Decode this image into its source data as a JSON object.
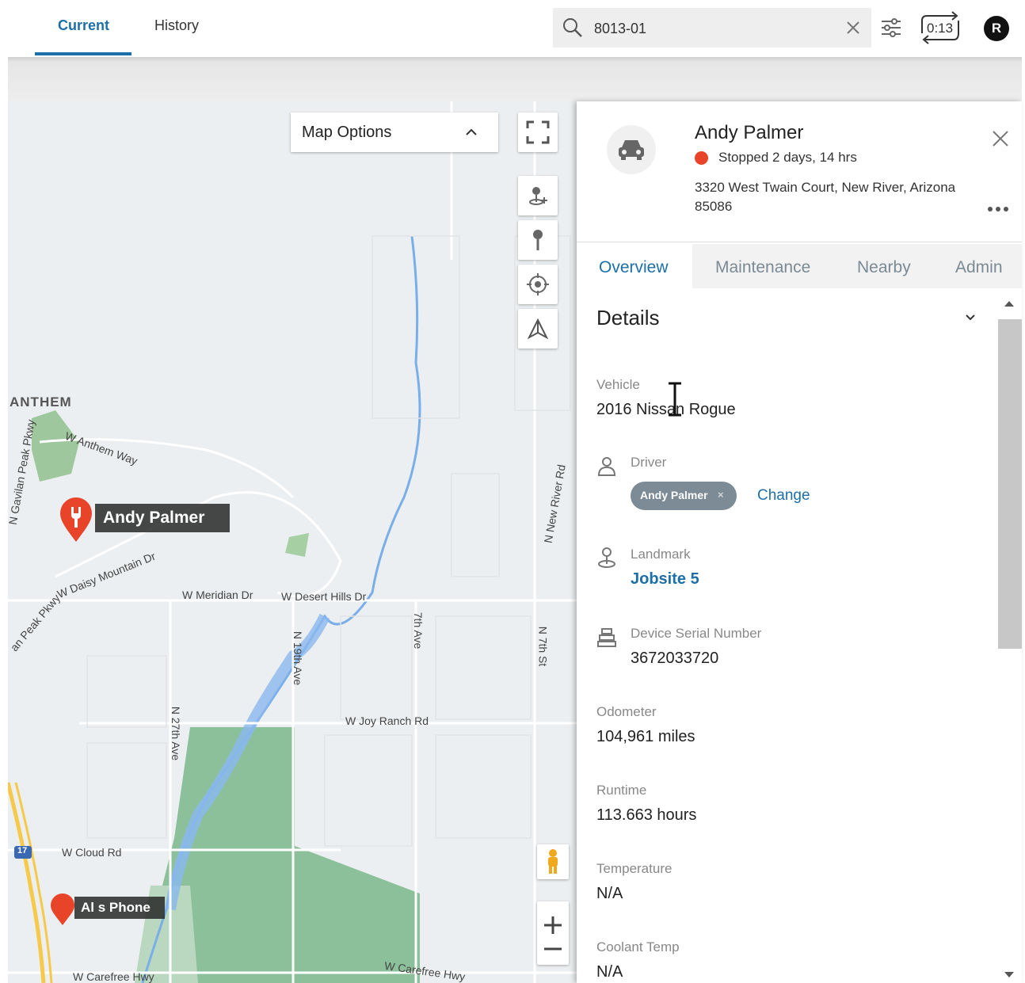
{
  "topbar": {
    "tabs": [
      {
        "label": "Current"
      },
      {
        "label": "History"
      }
    ],
    "search": {
      "value": "8013-01"
    },
    "timer": "0:13",
    "user_initial": "R"
  },
  "map": {
    "options_label": "Map Options",
    "markers": [
      {
        "label": "Andy Palmer"
      },
      {
        "label": "Al s Phone"
      }
    ],
    "places": {
      "anthem": "ANTHEM",
      "w_anthem_way": "W Anthem Way",
      "w_daisy": "W Daisy Mountain Dr",
      "w_meridian": "W Meridian Dr",
      "w_desert_hills": "W Desert Hills Dr",
      "n19th": "N 19th Ave",
      "ave7": "7th Ave",
      "n7th": "N 7th St",
      "w_joy": "W Joy Ranch Rd",
      "n27th": "N 27th Ave",
      "w_cloud": "W Cloud Rd",
      "w_carefree1": "W Carefree Hwy",
      "w_carefree2": "W Carefree Hwy",
      "n_new_river": "N New River Rd",
      "gavilan": "N Gavilan Peak Pkwy",
      "peak_pkwy": "an Peak Pkwy",
      "hwy17": "17"
    }
  },
  "panel": {
    "name": "Andy Palmer",
    "status": "Stopped 2 days, 14 hrs",
    "status_color": "#e8442a",
    "address": "3320 West Twain Court, New River, Arizona 85086",
    "tabs": [
      {
        "label": "Overview"
      },
      {
        "label": "Maintenance"
      },
      {
        "label": "Nearby"
      },
      {
        "label": "Admin"
      }
    ],
    "section_title": "Details",
    "vehicle": {
      "label": "Vehicle",
      "value": "2016 Nissan Rogue"
    },
    "driver": {
      "label": "Driver",
      "chip": "Andy Palmer",
      "change": "Change"
    },
    "landmark": {
      "label": "Landmark",
      "value": "Jobsite 5"
    },
    "device": {
      "label": "Device Serial Number",
      "value": "3672033720"
    },
    "odometer": {
      "label": "Odometer",
      "value": "104,961 miles"
    },
    "runtime": {
      "label": "Runtime",
      "value": "113.663 hours"
    },
    "temperature": {
      "label": "Temperature",
      "value": "N/A"
    },
    "coolant": {
      "label": "Coolant Temp",
      "value": "N/A"
    }
  },
  "colors": {
    "accent": "#1d6fa8",
    "marker": "#e8442a"
  }
}
